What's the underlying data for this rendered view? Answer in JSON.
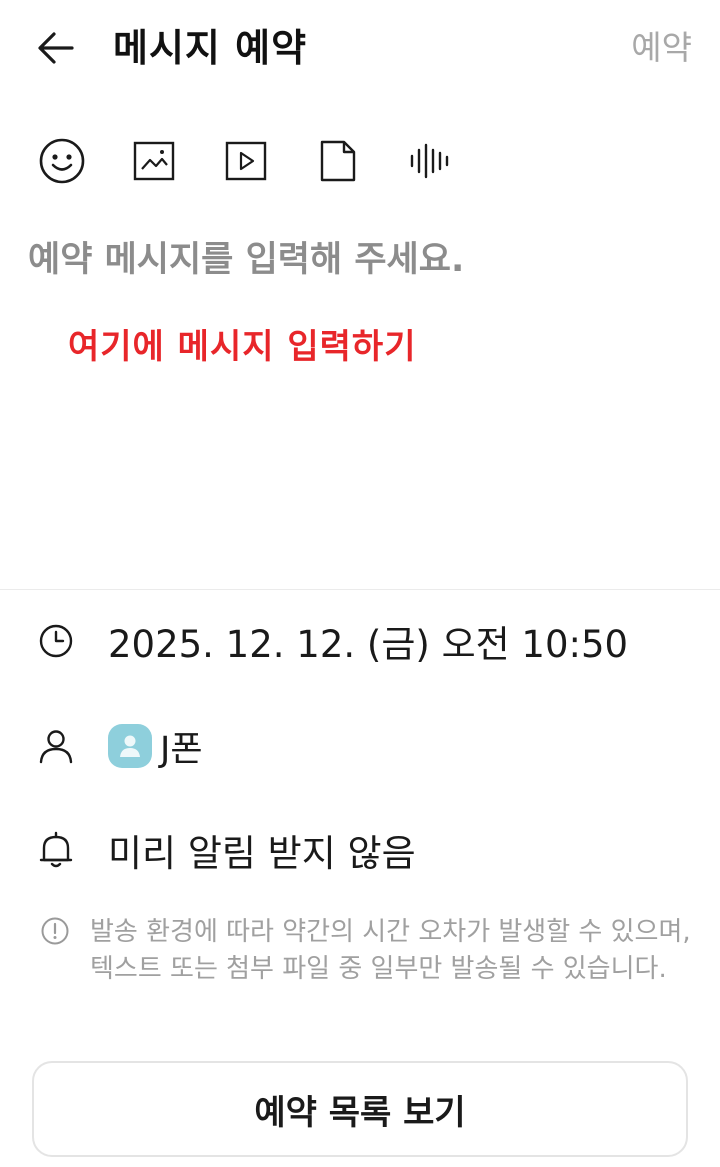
{
  "header": {
    "title": "메시지 예약",
    "reserve_label": "예약",
    "back_icon": "arrow-left-icon"
  },
  "toolbar": {
    "buttons": [
      {
        "icon": "emoji-icon"
      },
      {
        "icon": "image-icon"
      },
      {
        "icon": "video-icon"
      },
      {
        "icon": "file-icon"
      },
      {
        "icon": "voice-icon"
      }
    ]
  },
  "message": {
    "value": "",
    "placeholder": "예약 메시지를 입력해 주세요."
  },
  "annotation": {
    "text": "여기에 메시지 입력하기",
    "color": "#e8262a"
  },
  "schedule": {
    "datetime": "2025. 12. 12. (금) 오전 10:50",
    "icon": "clock-icon"
  },
  "recipient": {
    "name": "J폰",
    "icon": "person-icon",
    "avatar_color": "#8ecfdc"
  },
  "reminder": {
    "label": "미리 알림 받지 않음",
    "icon": "bell-icon"
  },
  "notice": {
    "text": "발송 환경에 따라 약간의 시간 오차가 발생할 수 있으며, 텍스트 또는 첨부 파일 중 일부만 발송될 수 있습니다.",
    "icon": "info-icon"
  },
  "footer": {
    "list_button_label": "예약 목록 보기"
  }
}
